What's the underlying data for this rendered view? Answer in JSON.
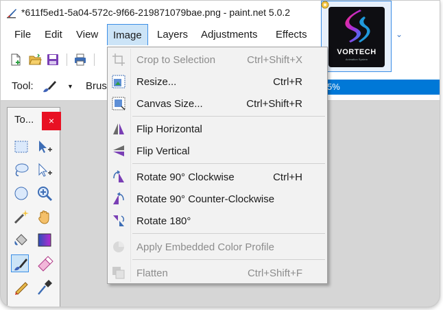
{
  "window": {
    "title": "*611f5ed1-5a04-572c-9f66-219871079bae.png - paint.net 5.0.2"
  },
  "menubar": {
    "items": [
      "File",
      "Edit",
      "View",
      "Image",
      "Layers",
      "Adjustments",
      "Effects"
    ],
    "active": "Image"
  },
  "thumbnail": {
    "brand": "VORTECH",
    "tagline": "Animation System"
  },
  "optionsbar": {
    "tool_label": "Tool:",
    "brush_label": "Brus",
    "zoom_fragment": "5%"
  },
  "tools_panel": {
    "title": "To...",
    "close_glyph": "×",
    "selected_tool": "paintbrush"
  },
  "image_menu": {
    "items": [
      {
        "label": "Crop to Selection",
        "shortcut": "Ctrl+Shift+X",
        "enabled": false,
        "icon": "crop-icon"
      },
      {
        "label": "Resize...",
        "shortcut": "Ctrl+R",
        "enabled": true,
        "icon": "resize-icon"
      },
      {
        "label": "Canvas Size...",
        "shortcut": "Ctrl+Shift+R",
        "enabled": true,
        "icon": "canvas-size-icon"
      },
      {
        "label": "Flip Horizontal",
        "shortcut": "",
        "enabled": true,
        "icon": "flip-horizontal-icon"
      },
      {
        "label": "Flip Vertical",
        "shortcut": "",
        "enabled": true,
        "icon": "flip-vertical-icon"
      },
      {
        "label": "Rotate 90° Clockwise",
        "shortcut": "Ctrl+H",
        "enabled": true,
        "icon": "rotate-cw-icon"
      },
      {
        "label": "Rotate 90° Counter-Clockwise",
        "shortcut": "",
        "enabled": true,
        "icon": "rotate-ccw-icon"
      },
      {
        "label": "Rotate 180°",
        "shortcut": "",
        "enabled": true,
        "icon": "rotate-180-icon"
      },
      {
        "label": "Apply Embedded Color Profile",
        "shortcut": "",
        "enabled": false,
        "icon": "color-profile-icon"
      },
      {
        "label": "Flatten",
        "shortcut": "Ctrl+Shift+F",
        "enabled": false,
        "icon": "flatten-icon"
      }
    ]
  },
  "colors": {
    "accent": "#0078d7",
    "menu_highlight": "#cce4f7",
    "close_red": "#e81123",
    "workspace": "#d6d6d6"
  }
}
